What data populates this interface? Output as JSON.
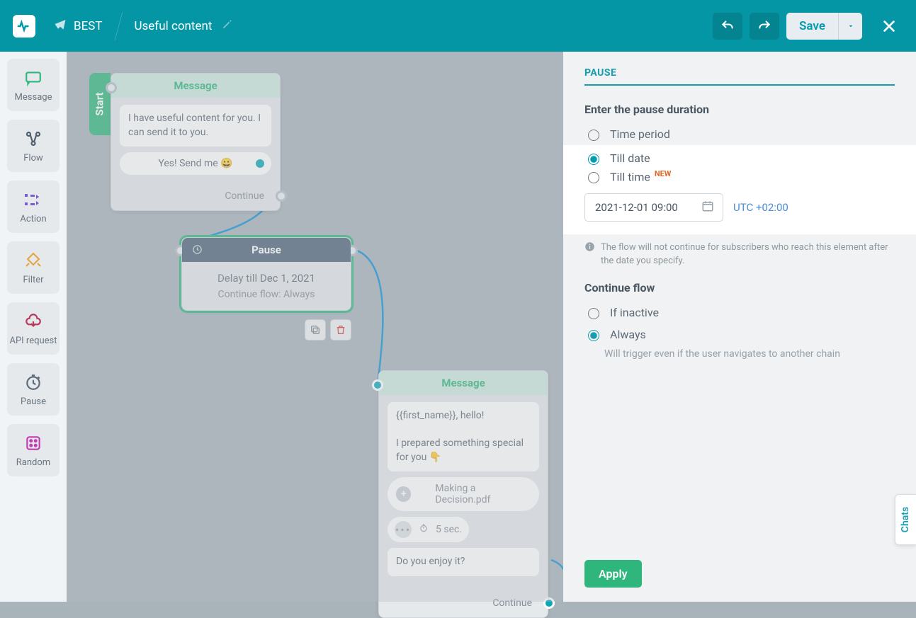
{
  "header": {
    "bot_name": "BEST",
    "flow_name": "Useful content",
    "save_label": "Save"
  },
  "toolbox": {
    "message": "Message",
    "flow": "Flow",
    "action": "Action",
    "filter": "Filter",
    "api": "API request",
    "pause": "Pause",
    "random": "Random"
  },
  "nodes": {
    "start_label": "Start",
    "msg1": {
      "title": "Message",
      "text": "I have useful content for you. I can send it to you.",
      "button": "Yes! Send me 😀",
      "continue": "Continue"
    },
    "pause": {
      "title": "Pause",
      "delay_prefix": "Delay till ",
      "delay_date": "Dec 1, 2021",
      "continue_line": "Continue flow: Always"
    },
    "msg2": {
      "title": "Message",
      "text": "{{first_name}}, hello!\n\nI prepared something special for you 👇",
      "file_name": "Making a Decision.pdf",
      "timer": "5 sec.",
      "text2": "Do you enjoy it?",
      "continue": "Continue"
    }
  },
  "panel": {
    "heading": "PAUSE",
    "duration_title": "Enter the pause duration",
    "opt_time_period": "Time period",
    "opt_till_date": "Till date",
    "opt_till_time": "Till time",
    "new_badge": "NEW",
    "date_value": "2021-12-01 09:00",
    "tz": "UTC +02:00",
    "info": "The flow will not continue for subscribers who reach this element after the date you specify.",
    "continue_title": "Continue flow",
    "opt_inactive": "If inactive",
    "opt_always": "Always",
    "always_hint": "Will trigger even if the user navigates to another chain",
    "apply": "Apply"
  },
  "chats_tab": "Chats"
}
